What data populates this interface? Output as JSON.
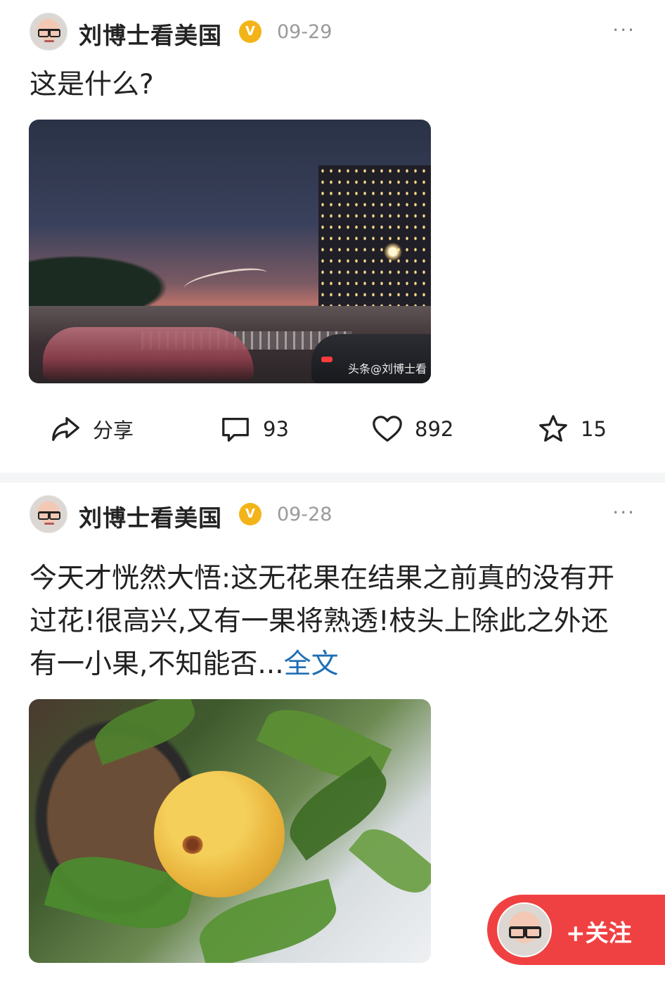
{
  "posts": [
    {
      "author": "刘博士看美国",
      "verified_badge": "V",
      "date": "09-29",
      "more": "···",
      "text": "这是什么?",
      "image_watermark": "头条@刘博士看",
      "actions": {
        "share_label": "分享",
        "comments": "93",
        "likes": "892",
        "favorites": "15"
      }
    },
    {
      "author": "刘博士看美国",
      "verified_badge": "V",
      "date": "09-28",
      "more": "···",
      "text": "今天才恍然大悟:这无花果在结果之前真的没有开过花!很高兴,又有一果将熟透!枝头上除此之外还有一小果,不知能否...",
      "fulltext_link": "全文"
    }
  ],
  "follow_button": {
    "label": "+关注"
  },
  "icons": [
    "share-icon",
    "comment-icon",
    "heart-icon",
    "star-icon",
    "verified-badge-icon",
    "more-icon"
  ],
  "colors": {
    "accent_red": "#f04142",
    "link_blue": "#1f6fb6",
    "badge_gold": "#f2b418"
  }
}
